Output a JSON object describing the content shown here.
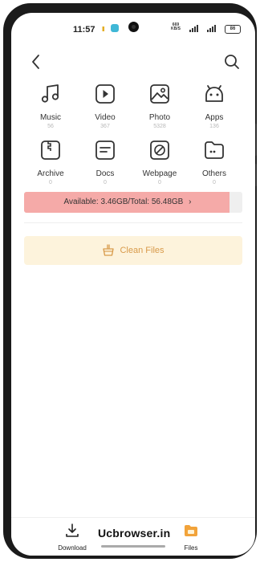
{
  "status_bar": {
    "time": "11:57",
    "pause_icon": "pause-icon",
    "net_speed": "669",
    "net_unit": "KB/S",
    "battery": "86"
  },
  "header": {
    "back_icon": "chevron-left-icon",
    "search_icon": "search-icon"
  },
  "categories": [
    {
      "label": "Music",
      "count": "56",
      "icon": "music-note-icon"
    },
    {
      "label": "Video",
      "count": "367",
      "icon": "video-play-icon"
    },
    {
      "label": "Photo",
      "count": "5328",
      "icon": "photo-icon"
    },
    {
      "label": "Apps",
      "count": "136",
      "icon": "android-icon"
    },
    {
      "label": "Archive",
      "count": "0",
      "icon": "archive-icon"
    },
    {
      "label": "Docs",
      "count": "0",
      "icon": "docs-icon"
    },
    {
      "label": "Webpage",
      "count": "0",
      "icon": "webpage-icon"
    },
    {
      "label": "Others",
      "count": "0",
      "icon": "folder-icon"
    }
  ],
  "storage": {
    "text": "Available: 3.46GB/Total: 56.48GB",
    "chevron": "›",
    "used_fraction": 0.94,
    "fill_color": "#f5aaa8"
  },
  "clean": {
    "label": "Clean Files",
    "icon": "broom-basket-icon",
    "bg_color": "#fdf3dc",
    "text_color": "#d89a4a"
  },
  "bottom_nav": {
    "download_label": "Download",
    "files_label": "Files"
  },
  "watermark": "Ucbrowser.in"
}
